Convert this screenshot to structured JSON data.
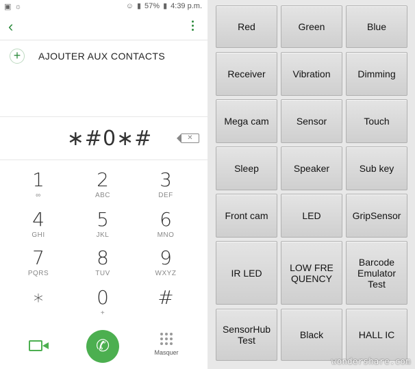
{
  "status_bar": {
    "battery": "57%",
    "time": "4:39 p.m."
  },
  "dialer": {
    "add_contact_label": "AJOUTER AUX CONTACTS",
    "dialed_number": "∗#0∗#",
    "keys": [
      {
        "digit": "1",
        "letters": "∞"
      },
      {
        "digit": "2",
        "letters": "ABC"
      },
      {
        "digit": "3",
        "letters": "DEF"
      },
      {
        "digit": "4",
        "letters": "GHI"
      },
      {
        "digit": "5",
        "letters": "JKL"
      },
      {
        "digit": "6",
        "letters": "MNO"
      },
      {
        "digit": "7",
        "letters": "PQRS"
      },
      {
        "digit": "8",
        "letters": "TUV"
      },
      {
        "digit": "9",
        "letters": "WXYZ"
      },
      {
        "digit": "∗",
        "letters": ""
      },
      {
        "digit": "0",
        "letters": "+"
      },
      {
        "digit": "#",
        "letters": ""
      }
    ],
    "hide_label": "Masquer",
    "accent_color": "#4caf50"
  },
  "test_menu": {
    "buttons": [
      {
        "label": "Red"
      },
      {
        "label": "Green"
      },
      {
        "label": "Blue"
      },
      {
        "label": "Receiver"
      },
      {
        "label": "Vibration"
      },
      {
        "label": "Dimming"
      },
      {
        "label": "Mega cam"
      },
      {
        "label": "Sensor"
      },
      {
        "label": "Touch"
      },
      {
        "label": "Sleep"
      },
      {
        "label": "Speaker"
      },
      {
        "label": "Sub key"
      },
      {
        "label": "Front cam"
      },
      {
        "label": "LED"
      },
      {
        "label": "GripSensor"
      },
      {
        "label": "IR LED"
      },
      {
        "label": "LOW FREQUENCY"
      },
      {
        "label": "Barcode Emulator Test"
      },
      {
        "label": "SensorHub Test"
      },
      {
        "label": "Black"
      },
      {
        "label": "HALL IC"
      }
    ]
  },
  "watermark": "wondershare.com"
}
